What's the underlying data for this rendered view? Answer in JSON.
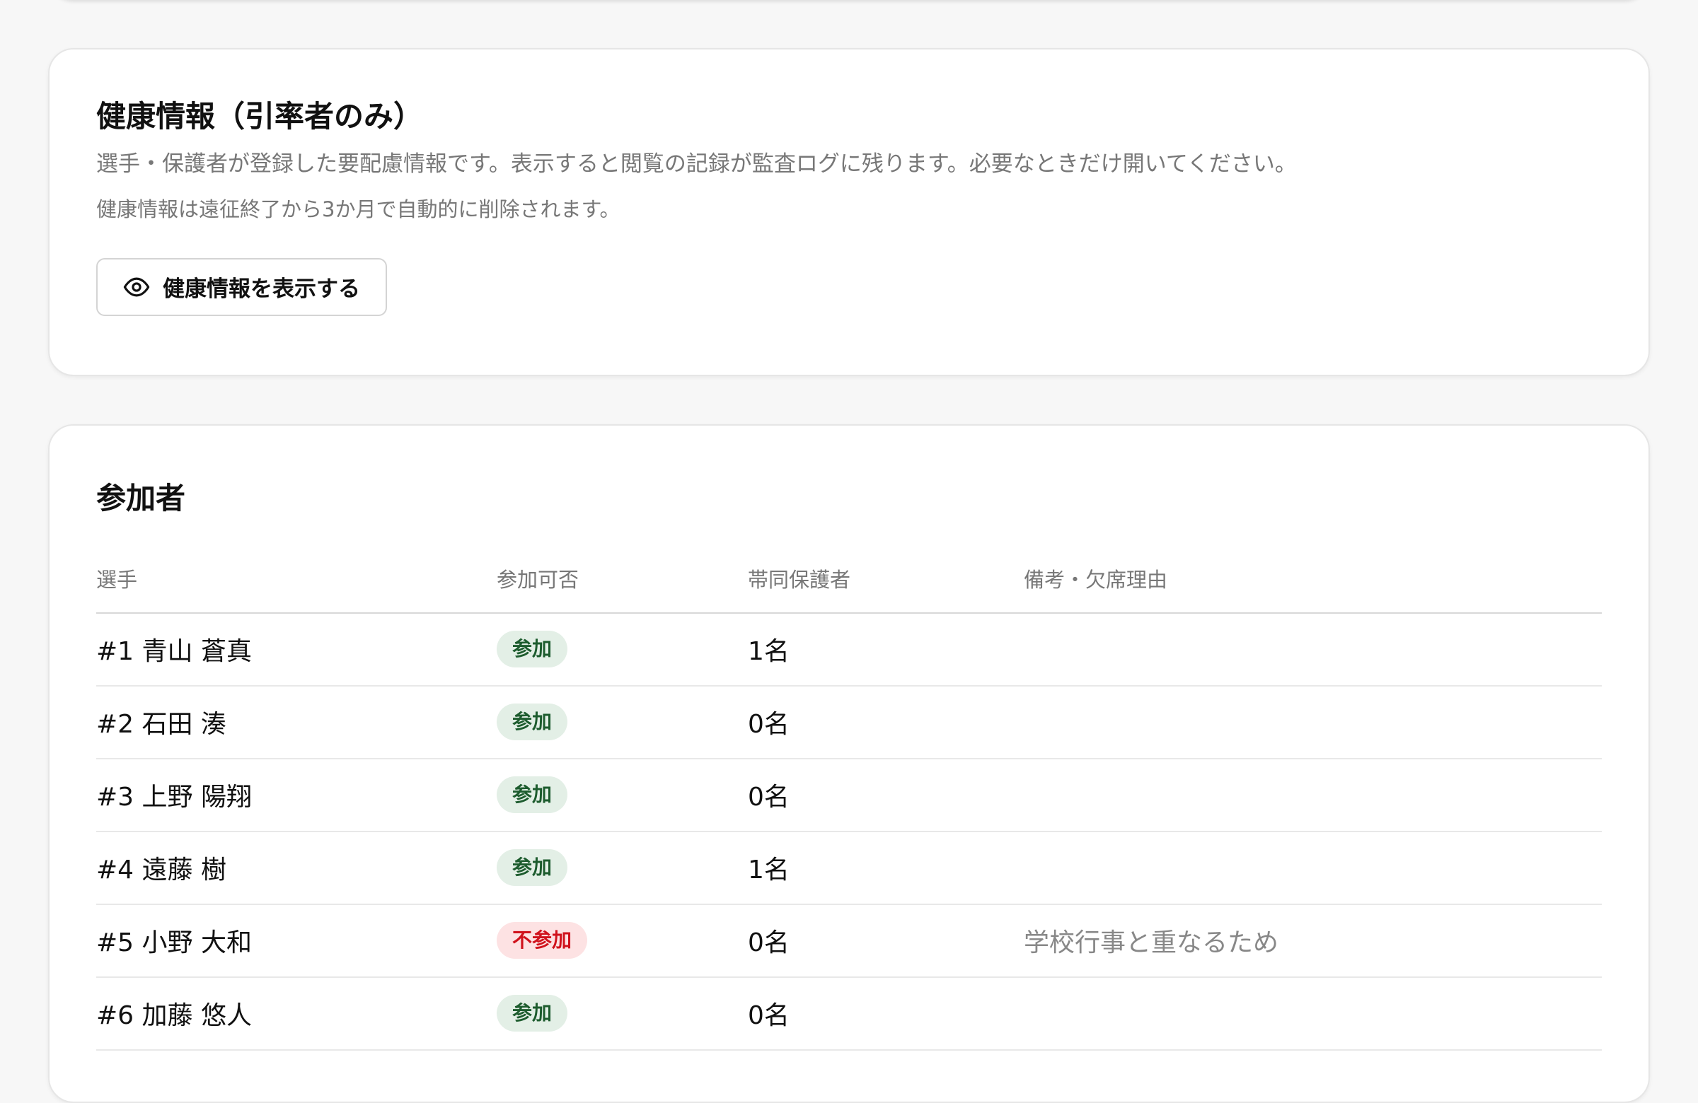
{
  "health": {
    "title": "健康情報（引率者のみ）",
    "description": "選手・保護者が登録した要配慮情報です。表示すると閲覧の記録が監査ログに残ります。必要なときだけ開いてください。",
    "note": "健康情報は遠征終了から3か月で自動的に削除されます。",
    "show_button_label": "健康情報を表示する",
    "show_button_icon": "eye-icon"
  },
  "participants": {
    "title": "参加者",
    "columns": [
      "選手",
      "参加可否",
      "帯同保護者",
      "備考・欠席理由"
    ],
    "rows": [
      {
        "player": "#1 青山 蒼真",
        "status": "参加",
        "status_type": "yes",
        "guardians": "1名",
        "note": ""
      },
      {
        "player": "#2 石田 湊",
        "status": "参加",
        "status_type": "yes",
        "guardians": "0名",
        "note": ""
      },
      {
        "player": "#3 上野 陽翔",
        "status": "参加",
        "status_type": "yes",
        "guardians": "0名",
        "note": ""
      },
      {
        "player": "#4 遠藤 樹",
        "status": "参加",
        "status_type": "yes",
        "guardians": "1名",
        "note": ""
      },
      {
        "player": "#5 小野 大和",
        "status": "不参加",
        "status_type": "no",
        "guardians": "0名",
        "note": "学校行事と重なるため"
      },
      {
        "player": "#6 加藤 悠人",
        "status": "参加",
        "status_type": "yes",
        "guardians": "0名",
        "note": ""
      }
    ]
  },
  "colors": {
    "attend_bg": "#e3efe6",
    "attend_text": "#1d5c2e",
    "absent_bg": "#fde2e3",
    "absent_text": "#d0121c"
  }
}
